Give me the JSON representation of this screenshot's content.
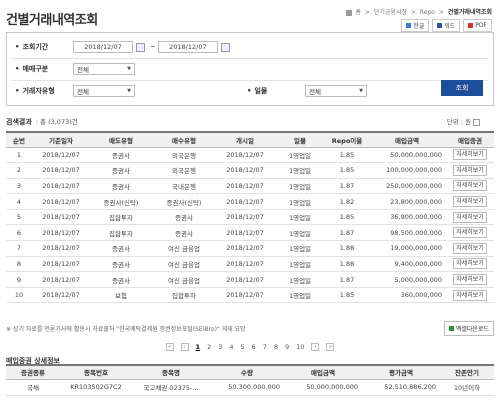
{
  "page": {
    "title": "건별거래내역조회",
    "breadcrumb": [
      "홈",
      "단기금융시장",
      "Repo",
      "건별거래내역조회"
    ],
    "tools": [
      {
        "label": "한글",
        "icon": "hwp-icon",
        "color": "#3a7bd5"
      },
      {
        "label": "워드",
        "icon": "word-icon",
        "color": "#2b579a"
      },
      {
        "label": "PDF",
        "icon": "pdf-icon",
        "color": "#d9302c"
      }
    ]
  },
  "search": {
    "period_label": "조회기간",
    "date_from": "2018/12/07",
    "date_sep": "~",
    "date_to": "2018/12/07",
    "trade_type_label": "매매구분",
    "trade_type_value": "전체",
    "party_type_label": "거래자유형",
    "party_type_value": "전체",
    "term_label": "일물",
    "term_value": "전체",
    "submit_label": "조회"
  },
  "results": {
    "title": "검색결과",
    "count": ": 총 (3,073)건",
    "unit_label": "단위 : 원",
    "columns": [
      "순번",
      "기준일자",
      "매도유형",
      "매수유형",
      "개시일",
      "일물",
      "Repo이율",
      "매입금액",
      "매입증권"
    ],
    "detail_label": "자세히보기",
    "rows": [
      {
        "no": "1",
        "date": "2018/12/07",
        "seller": "증권사",
        "buyer": "외국은행",
        "start": "2018/12/07",
        "term": "1영업일",
        "rate": "1.85",
        "amount": "50,000,000,000"
      },
      {
        "no": "2",
        "date": "2018/12/07",
        "seller": "증권사",
        "buyer": "외국은행",
        "start": "2018/12/07",
        "term": "1영업일",
        "rate": "1.85",
        "amount": "100,000,000,000"
      },
      {
        "no": "3",
        "date": "2018/12/07",
        "seller": "증권사",
        "buyer": "국내은행",
        "start": "2018/12/07",
        "term": "1영업일",
        "rate": "1.87",
        "amount": "250,000,000,000"
      },
      {
        "no": "4",
        "date": "2018/12/07",
        "seller": "증권사(신탁)",
        "buyer": "증권사(신탁)",
        "start": "2018/12/07",
        "term": "1영업일",
        "rate": "1.82",
        "amount": "23,800,000,000"
      },
      {
        "no": "5",
        "date": "2018/12/07",
        "seller": "집합투자",
        "buyer": "증권사",
        "start": "2018/12/07",
        "term": "1영업일",
        "rate": "1.85",
        "amount": "36,900,000,000"
      },
      {
        "no": "6",
        "date": "2018/12/07",
        "seller": "집합투자",
        "buyer": "증권사",
        "start": "2018/12/07",
        "term": "1영업일",
        "rate": "1.87",
        "amount": "98,500,000,000"
      },
      {
        "no": "7",
        "date": "2018/12/07",
        "seller": "증권사",
        "buyer": "여신 금융업",
        "start": "2018/12/07",
        "term": "1영업일",
        "rate": "1.88",
        "amount": "19,000,000,000"
      },
      {
        "no": "8",
        "date": "2018/12/07",
        "seller": "증권사",
        "buyer": "여신 금융업",
        "start": "2018/12/07",
        "term": "1영업일",
        "rate": "1.88",
        "amount": "9,400,000,000"
      },
      {
        "no": "9",
        "date": "2018/12/07",
        "seller": "증권사",
        "buyer": "여신 금융업",
        "start": "2018/12/07",
        "term": "1영업일",
        "rate": "1.87",
        "amount": "5,000,000,000"
      },
      {
        "no": "10",
        "date": "2018/12/07",
        "seller": "보험",
        "buyer": "집합투자",
        "start": "2018/12/07",
        "term": "1영업일",
        "rate": "1.85",
        "amount": "360,000,000"
      }
    ],
    "note": "※ 상기 자료를 언론기사에 활용시 자료출처 \"한국예탁결제원 증권정보포털(SEIBro)\" 게재 요망",
    "excel_label": "엑셀다운로드"
  },
  "pager": {
    "first": "«",
    "prev": "‹",
    "pages": [
      "1",
      "2",
      "3",
      "4",
      "5",
      "6",
      "7",
      "8",
      "9",
      "10"
    ],
    "active": "1",
    "next": "›",
    "last": "»"
  },
  "detail": {
    "title": "매입증권 상세정보",
    "columns": [
      "증권종류",
      "종목번호",
      "종목명",
      "수량",
      "매입금액",
      "평가금액",
      "잔존만기"
    ],
    "rows": [
      {
        "kind": "국채",
        "code": "KR103502G7C2",
        "name": "국고채권 02375-...",
        "qty": "50,300,000,000",
        "amount": "50,000,000,000",
        "value": "52,510,886,200",
        "maturity": "10년이하"
      }
    ]
  }
}
